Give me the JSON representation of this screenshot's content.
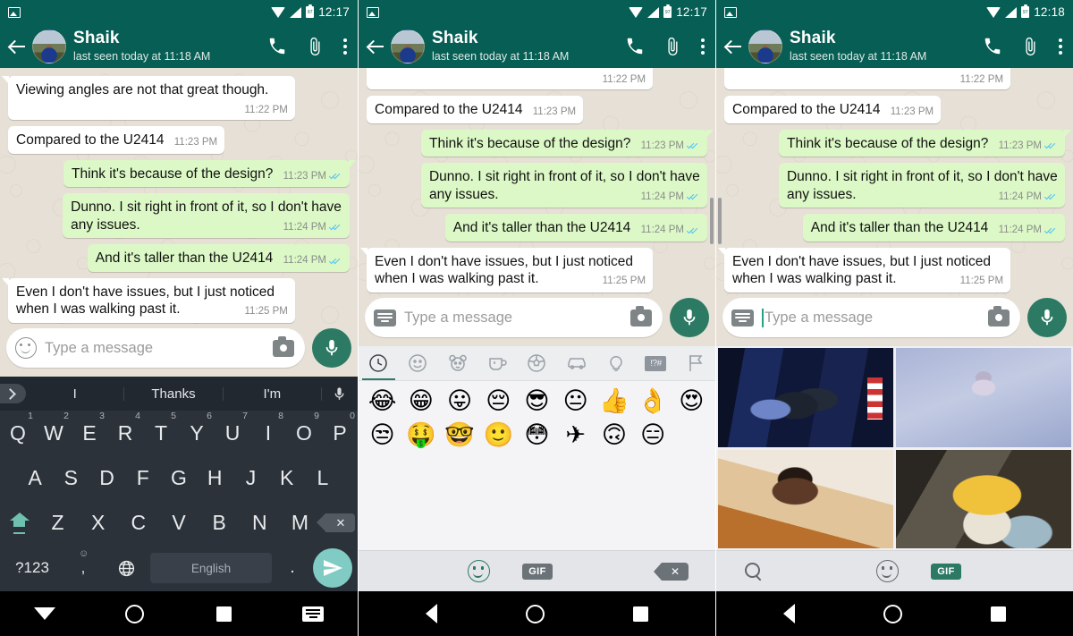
{
  "app": {
    "accent": "#075e54",
    "bubble_out": "#dcf8c6",
    "bubble_in": "#ffffff",
    "chat_bg": "#e7e0d6"
  },
  "panels": [
    {
      "status": {
        "time": "12:17",
        "icons": [
          "image-notification-icon",
          "wifi-icon",
          "signal-icon",
          "battery-icon"
        ]
      },
      "header": {
        "back": "back-arrow",
        "avatar": "contact-avatar",
        "name": "Shaik",
        "status": "last seen today at 11:18 AM",
        "actions": [
          "call-icon",
          "attach-icon",
          "overflow-icon"
        ]
      },
      "composer": {
        "left_icon": "emoji-icon",
        "placeholder": "Type a message",
        "camera": "camera-icon",
        "fab": "mic-icon",
        "has_caret": false
      },
      "bottom": "keyboard",
      "nav": [
        "down-arrow",
        "home",
        "recents",
        "keyboard"
      ]
    },
    {
      "status": {
        "time": "12:17"
      },
      "header": {
        "name": "Shaik",
        "status": "last seen today at 11:18 AM"
      },
      "composer": {
        "left_icon": "keyboard-icon",
        "placeholder": "Type a message",
        "camera": "camera-icon",
        "fab": "mic-icon",
        "has_caret": false
      },
      "bottom": "emoji",
      "nav": [
        "back",
        "home",
        "recents"
      ]
    },
    {
      "status": {
        "time": "12:18"
      },
      "header": {
        "name": "Shaik",
        "status": "last seen today at 11:18 AM"
      },
      "composer": {
        "left_icon": "keyboard-icon",
        "placeholder": "Type a message",
        "camera": "camera-icon",
        "fab": "mic-icon",
        "has_caret": true
      },
      "bottom": "gif",
      "nav": [
        "back",
        "home",
        "recents"
      ]
    }
  ],
  "messages": [
    {
      "dir": "in",
      "text": "Viewing angles are not that great though.",
      "time": "11:22 PM",
      "ticks": false,
      "layout": "stack",
      "tail": true
    },
    {
      "dir": "in",
      "text": "Compared to the U2414",
      "time": "11:23 PM",
      "ticks": false,
      "layout": "inline",
      "tail": false
    },
    {
      "dir": "out",
      "text": "Think it's because of the design?",
      "time": "11:23 PM",
      "ticks": true,
      "layout": "inline",
      "tail": true
    },
    {
      "dir": "out",
      "text": "Dunno. I sit right in front of it, so I don't have any issues.",
      "time": "11:24 PM",
      "ticks": true,
      "layout": "stack",
      "tail": false
    },
    {
      "dir": "out",
      "text": "And it's taller than the U2414",
      "time": "11:24 PM",
      "ticks": true,
      "layout": "inline",
      "tail": false
    },
    {
      "dir": "in",
      "text": "Even I don't have issues, but I just noticed when I was walking past it.",
      "time": "11:25 PM",
      "ticks": false,
      "layout": "stack",
      "tail": true
    }
  ],
  "keyboard": {
    "suggestions": [
      "I",
      "Thanks",
      "I'm"
    ],
    "expand_icon": "chevron-right-icon",
    "mic_icon": "mic-icon",
    "row1": [
      {
        "k": "Q",
        "n": "1"
      },
      {
        "k": "W",
        "n": "2"
      },
      {
        "k": "E",
        "n": "3"
      },
      {
        "k": "R",
        "n": "4"
      },
      {
        "k": "T",
        "n": "5"
      },
      {
        "k": "Y",
        "n": "6"
      },
      {
        "k": "U",
        "n": "7"
      },
      {
        "k": "I",
        "n": "8"
      },
      {
        "k": "O",
        "n": "9"
      },
      {
        "k": "P",
        "n": "0"
      }
    ],
    "row2": [
      "A",
      "S",
      "D",
      "F",
      "G",
      "H",
      "J",
      "K",
      "L"
    ],
    "row3": [
      "Z",
      "X",
      "C",
      "V",
      "B",
      "N",
      "M"
    ],
    "shift_icon": "shift-icon",
    "backspace_icon": "backspace-icon",
    "numeric_label": "?123",
    "comma_label": ",",
    "comma_sup": "emoji-icon",
    "globe_icon": "language-globe-icon",
    "space_label": "English",
    "period_label": ".",
    "send_icon": "send-icon"
  },
  "emoji_picker": {
    "tabs": [
      {
        "name": "recent-clock-icon",
        "active": true
      },
      {
        "name": "smileys-icon",
        "active": false
      },
      {
        "name": "animals-icon",
        "active": false
      },
      {
        "name": "food-drink-icon",
        "active": false
      },
      {
        "name": "sports-icon",
        "active": false
      },
      {
        "name": "travel-icon",
        "active": false
      },
      {
        "name": "objects-bulb-icon",
        "active": false
      },
      {
        "name": "symbols-icon",
        "active": false
      },
      {
        "name": "flags-icon",
        "active": false
      }
    ],
    "symbols_label": "!?#",
    "row1": [
      "😂",
      "😁",
      "😛",
      "😔",
      "😎",
      "😐",
      "👍",
      "👌",
      "😍"
    ],
    "row2": [
      "😒",
      "🤑",
      "🤓",
      "🙂",
      "😳",
      "✈",
      "🙃",
      "😑"
    ],
    "footer": {
      "smiley": "emoji-icon",
      "gif": "GIF",
      "backspace": "backspace-icon"
    }
  },
  "gif_picker": {
    "cells": [
      "gif-thumbnail-1",
      "gif-thumbnail-2",
      "gif-thumbnail-3",
      "gif-thumbnail-4"
    ],
    "footer": {
      "search": "search-icon",
      "smiley": "emoji-icon",
      "gif": "GIF"
    }
  }
}
